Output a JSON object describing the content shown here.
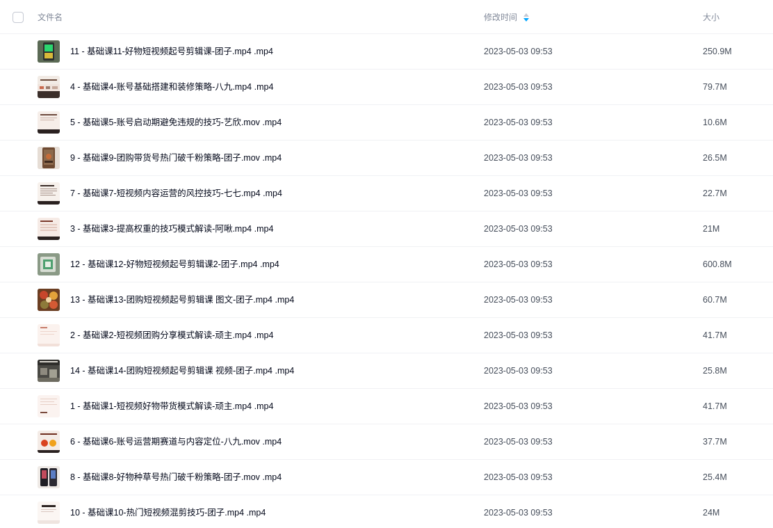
{
  "header": {
    "name_label": "文件名",
    "time_label": "修改时间",
    "size_label": "大小"
  },
  "files": [
    {
      "name": "11 - 基础课11-好物短视频起号剪辑课-团子.mp4 .mp4",
      "time": "2023-05-03 09:53",
      "size": "250.9M",
      "thumb": "green-screen"
    },
    {
      "name": "4 - 基础课4-账号基础搭建和装修策略-八九.mp4 .mp4",
      "time": "2023-05-03 09:53",
      "size": "79.7M",
      "thumb": "slide-brown"
    },
    {
      "name": "5 - 基础课5-账号启动期避免违规的技巧-艺欣.mov .mp4",
      "time": "2023-05-03 09:53",
      "size": "10.6M",
      "thumb": "slide-light"
    },
    {
      "name": "9 - 基础课9-团购带货号热门破千粉策略-团子.mov .mp4",
      "time": "2023-05-03 09:53",
      "size": "26.5M",
      "thumb": "phone-photo"
    },
    {
      "name": "7 - 基础课7-短视频内容运营的风控技巧-七七.mp4 .mp4",
      "time": "2023-05-03 09:53",
      "size": "22.7M",
      "thumb": "slide-text"
    },
    {
      "name": "3 - 基础课3-提高权重的技巧模式解读-阿啾.mp4 .mp4",
      "time": "2023-05-03 09:53",
      "size": "21M",
      "thumb": "slide-list"
    },
    {
      "name": "12 - 基础课12-好物短视频起号剪辑课2-团子.mp4 .mp4",
      "time": "2023-05-03 09:53",
      "size": "600.8M",
      "thumb": "green-box"
    },
    {
      "name": "13 - 基础课13-团购短视频起号剪辑课 图文-团子.mp4 .mp4",
      "time": "2023-05-03 09:53",
      "size": "60.7M",
      "thumb": "food"
    },
    {
      "name": "2 - 基础课2-短视频团购分享模式解读-顽主.mp4 .mp4",
      "time": "2023-05-03 09:53",
      "size": "41.7M",
      "thumb": "slide-pink"
    },
    {
      "name": "14 - 基础课14-团购短视频起号剪辑课 视频-团子.mp4 .mp4",
      "time": "2023-05-03 09:53",
      "size": "25.8M",
      "thumb": "dark-photo"
    },
    {
      "name": "1 - 基础课1-短视频好物带货模式解读-顽主.mp4 .mp4",
      "time": "2023-05-03 09:53",
      "size": "41.7M",
      "thumb": "slide-pink2"
    },
    {
      "name": "6 - 基础课6-账号运营期赛道与内容定位-八九.mov .mp4",
      "time": "2023-05-03 09:53",
      "size": "37.7M",
      "thumb": "slide-orange"
    },
    {
      "name": "8 - 基础课8-好物种草号热门破千粉策略-团子.mov .mp4",
      "time": "2023-05-03 09:53",
      "size": "25.4M",
      "thumb": "phones"
    },
    {
      "name": "10 - 基础课10-热门短视频混剪技巧-团子.mp4 .mp4",
      "time": "2023-05-03 09:53",
      "size": "24M",
      "thumb": "slide-title"
    }
  ],
  "colors": {
    "accent": "#06a7ff",
    "text_primary": "#03081a",
    "text_secondary": "#454d5a",
    "header_text": "#818999",
    "divider": "#f0f1f4"
  }
}
